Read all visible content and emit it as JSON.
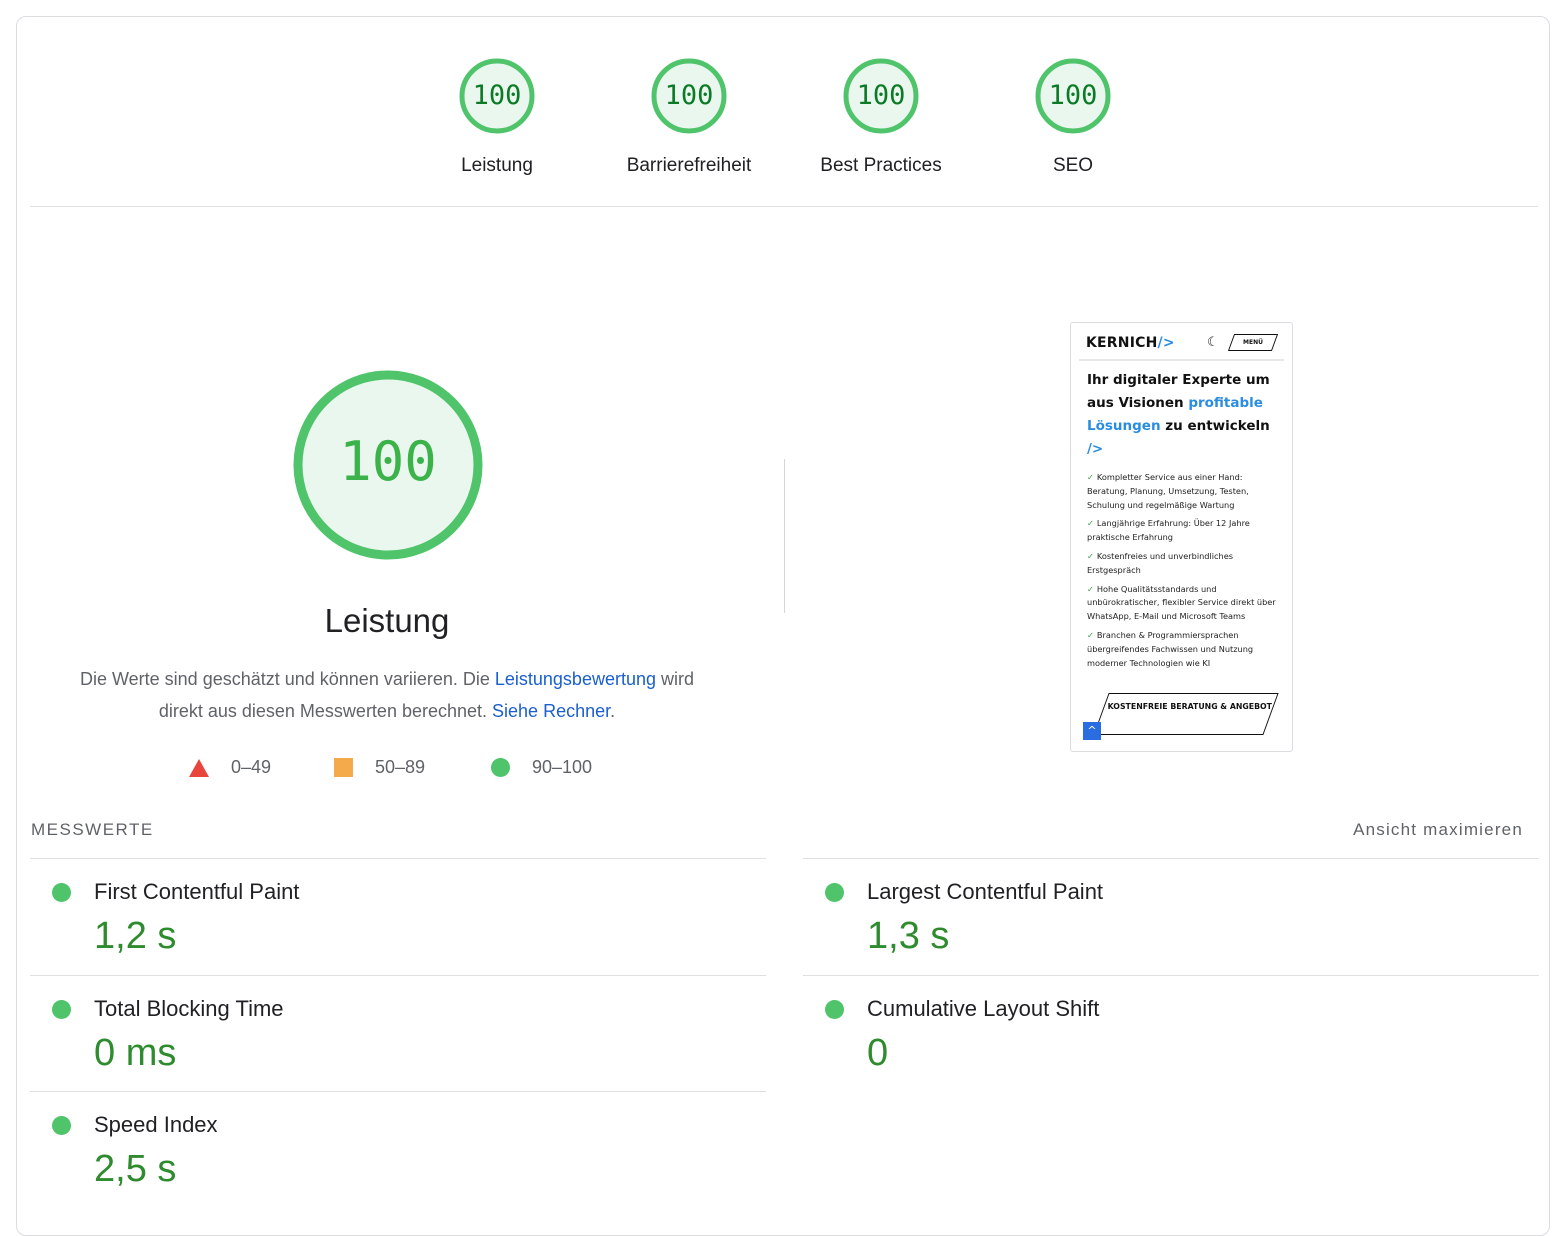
{
  "gauges": [
    {
      "score": "100",
      "label": "Leistung"
    },
    {
      "score": "100",
      "label": "Barrierefreiheit"
    },
    {
      "score": "100",
      "label": "Best Practices"
    },
    {
      "score": "100",
      "label": "SEO"
    }
  ],
  "performance": {
    "score": "100",
    "title": "Leistung",
    "desc_part1": "Die Werte sind geschätzt und können variieren. Die ",
    "desc_link1": "Leistungsbewertung",
    "desc_part2": " wird direkt aus diesen Messwerten berechnet. ",
    "desc_link2": "Siehe Rechner",
    "desc_part3": "."
  },
  "legend": [
    {
      "range": "0–49",
      "shape": "triangle",
      "color": "#e8453c"
    },
    {
      "range": "50–89",
      "shape": "square",
      "color": "#f4a94b"
    },
    {
      "range": "90–100",
      "shape": "circle",
      "color": "#4fc46a"
    }
  ],
  "screenshot": {
    "logo_text": "KERNICH",
    "logo_accent": "/>",
    "moon_icon": "moon-icon",
    "menu_label": "MENÜ",
    "headline_1": "Ihr digitaler Experte um aus Visionen",
    "headline_blue": "profitable Lösungen",
    "headline_2": " zu entwickeln",
    "headline_accent": "/>",
    "items": [
      "Kompletter Service aus einer Hand: Beratung, Planung, Umsetzung, Testen, Schulung und regelmäßige Wartung",
      "Langjährige Erfahrung: Über 12 Jahre praktische Erfahrung",
      "Kostenfreies und unverbindliches Erstgespräch",
      "Hohe Qualitätsstandards und unbürokratischer, flexibler Service direkt über WhatsApp, E-Mail und Microsoft Teams",
      "Branchen & Programmiersprachen übergreifendes Fachwissen und Nutzung moderner Technologien wie KI"
    ],
    "cta_label": "KOSTENFREIE BERATUNG & ANGEBOT"
  },
  "metrics_section": {
    "title": "MESSWERTE",
    "expand_label": "Ansicht maximieren"
  },
  "metrics": [
    {
      "name": "First Contentful Paint",
      "value": "1,2 s"
    },
    {
      "name": "Largest Contentful Paint",
      "value": "1,3 s"
    },
    {
      "name": "Total Blocking Time",
      "value": "0 ms"
    },
    {
      "name": "Cumulative Layout Shift",
      "value": "0"
    },
    {
      "name": "Speed Index",
      "value": "2,5 s"
    }
  ],
  "colors": {
    "pass_green": "#4fc46a",
    "pass_text": "#0d7a26",
    "pass_fill": "#eaf7ee",
    "link": "#1a5fd0"
  }
}
